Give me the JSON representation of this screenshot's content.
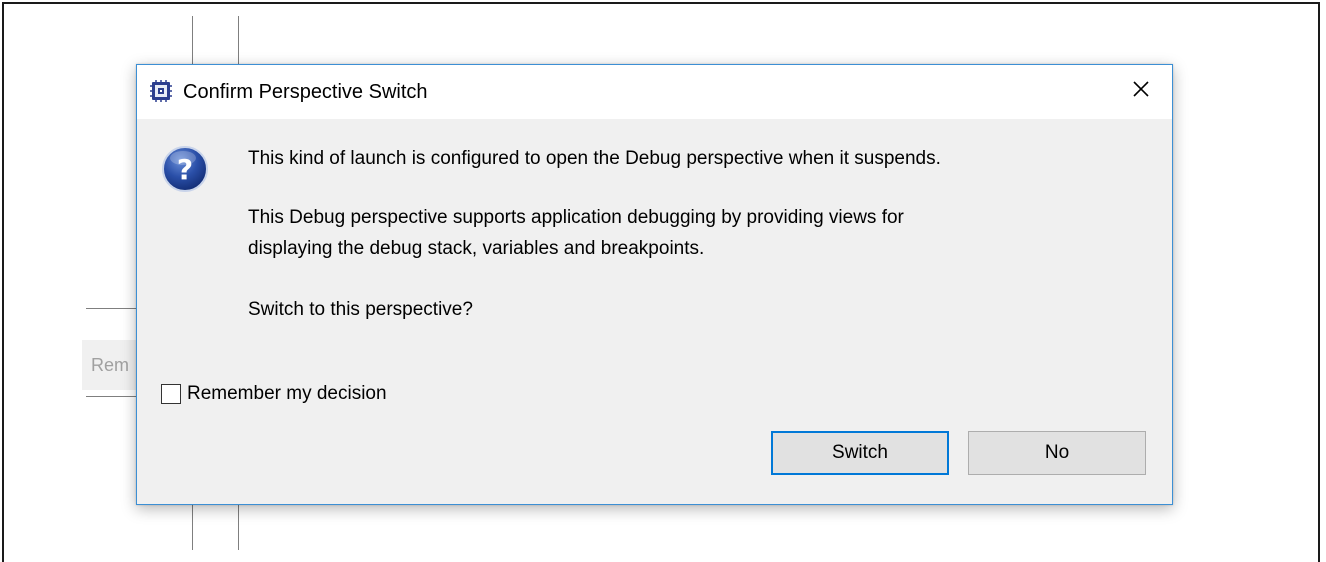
{
  "background": {
    "partial_button_label": "Rem"
  },
  "dialog": {
    "title": "Confirm Perspective Switch",
    "app_icon": "eclipse-app-icon",
    "close_icon": "close-x-icon",
    "question_icon": "question-mark-icon",
    "message_line1": "This kind of launch is configured to open the Debug perspective when it suspends.",
    "message_line2": "This Debug perspective supports application debugging by providing views for",
    "message_line3": "displaying the debug stack, variables and breakpoints.",
    "message_line4": "Switch to this perspective?",
    "checkbox_label": "Remember my decision",
    "checkbox_checked": false,
    "switch_label": "Switch",
    "no_label": "No",
    "accent_color": "#0078d7",
    "border_color": "#3c8fd4"
  }
}
